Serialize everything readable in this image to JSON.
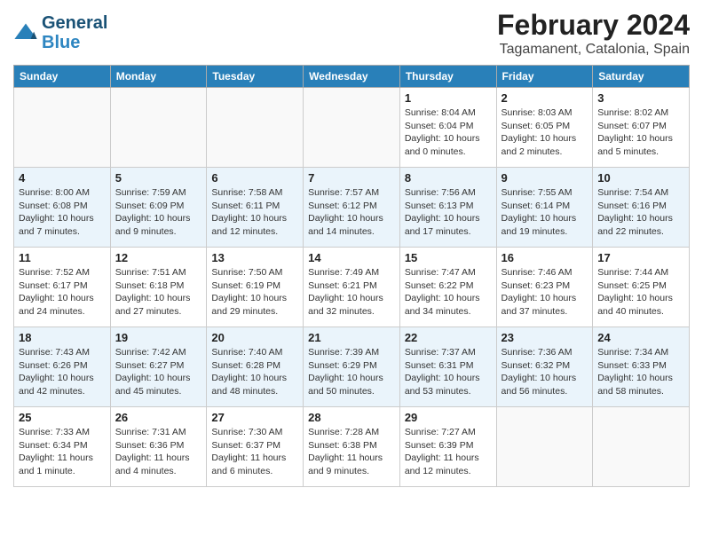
{
  "header": {
    "logo_line1": "General",
    "logo_line2": "Blue",
    "title": "February 2024",
    "subtitle": "Tagamanent, Catalonia, Spain"
  },
  "days_of_week": [
    "Sunday",
    "Monday",
    "Tuesday",
    "Wednesday",
    "Thursday",
    "Friday",
    "Saturday"
  ],
  "weeks": [
    [
      {
        "day": "",
        "info": ""
      },
      {
        "day": "",
        "info": ""
      },
      {
        "day": "",
        "info": ""
      },
      {
        "day": "",
        "info": ""
      },
      {
        "day": "1",
        "info": "Sunrise: 8:04 AM\nSunset: 6:04 PM\nDaylight: 10 hours and 0 minutes."
      },
      {
        "day": "2",
        "info": "Sunrise: 8:03 AM\nSunset: 6:05 PM\nDaylight: 10 hours and 2 minutes."
      },
      {
        "day": "3",
        "info": "Sunrise: 8:02 AM\nSunset: 6:07 PM\nDaylight: 10 hours and 5 minutes."
      }
    ],
    [
      {
        "day": "4",
        "info": "Sunrise: 8:00 AM\nSunset: 6:08 PM\nDaylight: 10 hours and 7 minutes."
      },
      {
        "day": "5",
        "info": "Sunrise: 7:59 AM\nSunset: 6:09 PM\nDaylight: 10 hours and 9 minutes."
      },
      {
        "day": "6",
        "info": "Sunrise: 7:58 AM\nSunset: 6:11 PM\nDaylight: 10 hours and 12 minutes."
      },
      {
        "day": "7",
        "info": "Sunrise: 7:57 AM\nSunset: 6:12 PM\nDaylight: 10 hours and 14 minutes."
      },
      {
        "day": "8",
        "info": "Sunrise: 7:56 AM\nSunset: 6:13 PM\nDaylight: 10 hours and 17 minutes."
      },
      {
        "day": "9",
        "info": "Sunrise: 7:55 AM\nSunset: 6:14 PM\nDaylight: 10 hours and 19 minutes."
      },
      {
        "day": "10",
        "info": "Sunrise: 7:54 AM\nSunset: 6:16 PM\nDaylight: 10 hours and 22 minutes."
      }
    ],
    [
      {
        "day": "11",
        "info": "Sunrise: 7:52 AM\nSunset: 6:17 PM\nDaylight: 10 hours and 24 minutes."
      },
      {
        "day": "12",
        "info": "Sunrise: 7:51 AM\nSunset: 6:18 PM\nDaylight: 10 hours and 27 minutes."
      },
      {
        "day": "13",
        "info": "Sunrise: 7:50 AM\nSunset: 6:19 PM\nDaylight: 10 hours and 29 minutes."
      },
      {
        "day": "14",
        "info": "Sunrise: 7:49 AM\nSunset: 6:21 PM\nDaylight: 10 hours and 32 minutes."
      },
      {
        "day": "15",
        "info": "Sunrise: 7:47 AM\nSunset: 6:22 PM\nDaylight: 10 hours and 34 minutes."
      },
      {
        "day": "16",
        "info": "Sunrise: 7:46 AM\nSunset: 6:23 PM\nDaylight: 10 hours and 37 minutes."
      },
      {
        "day": "17",
        "info": "Sunrise: 7:44 AM\nSunset: 6:25 PM\nDaylight: 10 hours and 40 minutes."
      }
    ],
    [
      {
        "day": "18",
        "info": "Sunrise: 7:43 AM\nSunset: 6:26 PM\nDaylight: 10 hours and 42 minutes."
      },
      {
        "day": "19",
        "info": "Sunrise: 7:42 AM\nSunset: 6:27 PM\nDaylight: 10 hours and 45 minutes."
      },
      {
        "day": "20",
        "info": "Sunrise: 7:40 AM\nSunset: 6:28 PM\nDaylight: 10 hours and 48 minutes."
      },
      {
        "day": "21",
        "info": "Sunrise: 7:39 AM\nSunset: 6:29 PM\nDaylight: 10 hours and 50 minutes."
      },
      {
        "day": "22",
        "info": "Sunrise: 7:37 AM\nSunset: 6:31 PM\nDaylight: 10 hours and 53 minutes."
      },
      {
        "day": "23",
        "info": "Sunrise: 7:36 AM\nSunset: 6:32 PM\nDaylight: 10 hours and 56 minutes."
      },
      {
        "day": "24",
        "info": "Sunrise: 7:34 AM\nSunset: 6:33 PM\nDaylight: 10 hours and 58 minutes."
      }
    ],
    [
      {
        "day": "25",
        "info": "Sunrise: 7:33 AM\nSunset: 6:34 PM\nDaylight: 11 hours and 1 minute."
      },
      {
        "day": "26",
        "info": "Sunrise: 7:31 AM\nSunset: 6:36 PM\nDaylight: 11 hours and 4 minutes."
      },
      {
        "day": "27",
        "info": "Sunrise: 7:30 AM\nSunset: 6:37 PM\nDaylight: 11 hours and 6 minutes."
      },
      {
        "day": "28",
        "info": "Sunrise: 7:28 AM\nSunset: 6:38 PM\nDaylight: 11 hours and 9 minutes."
      },
      {
        "day": "29",
        "info": "Sunrise: 7:27 AM\nSunset: 6:39 PM\nDaylight: 11 hours and 12 minutes."
      },
      {
        "day": "",
        "info": ""
      },
      {
        "day": "",
        "info": ""
      }
    ]
  ]
}
